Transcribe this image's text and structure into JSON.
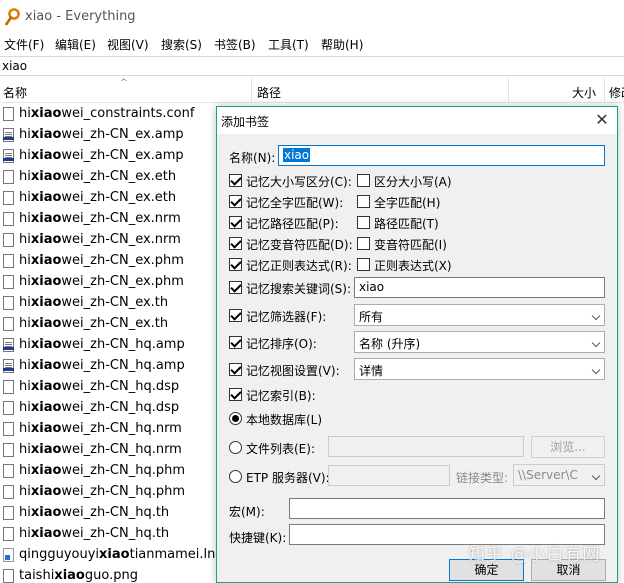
{
  "window": {
    "title": "xiao - Everything",
    "menu": [
      "文件(F)",
      "编辑(E)",
      "视图(V)",
      "搜索(S)",
      "书签(B)",
      "工具(T)",
      "帮助(H)"
    ],
    "search_value": "xiao"
  },
  "columns": {
    "name": "名称",
    "path": "路径",
    "size": "大小",
    "modified": "修改"
  },
  "files": [
    {
      "pre": "hi",
      "hl": "xiao",
      "post": "wei_constraints.conf",
      "icon": "file-icon"
    },
    {
      "pre": "hi",
      "hl": "xiao",
      "post": "wei_zh-CN_ex.amp",
      "icon": "amp-file-icon"
    },
    {
      "pre": "hi",
      "hl": "xiao",
      "post": "wei_zh-CN_ex.amp",
      "icon": "amp-file-icon"
    },
    {
      "pre": "hi",
      "hl": "xiao",
      "post": "wei_zh-CN_ex.eth",
      "icon": "file-icon"
    },
    {
      "pre": "hi",
      "hl": "xiao",
      "post": "wei_zh-CN_ex.eth",
      "icon": "file-icon"
    },
    {
      "pre": "hi",
      "hl": "xiao",
      "post": "wei_zh-CN_ex.nrm",
      "icon": "file-icon"
    },
    {
      "pre": "hi",
      "hl": "xiao",
      "post": "wei_zh-CN_ex.nrm",
      "icon": "file-icon"
    },
    {
      "pre": "hi",
      "hl": "xiao",
      "post": "wei_zh-CN_ex.phm",
      "icon": "file-icon"
    },
    {
      "pre": "hi",
      "hl": "xiao",
      "post": "wei_zh-CN_ex.phm",
      "icon": "file-icon"
    },
    {
      "pre": "hi",
      "hl": "xiao",
      "post": "wei_zh-CN_ex.th",
      "icon": "file-icon"
    },
    {
      "pre": "hi",
      "hl": "xiao",
      "post": "wei_zh-CN_ex.th",
      "icon": "file-icon"
    },
    {
      "pre": "hi",
      "hl": "xiao",
      "post": "wei_zh-CN_hq.amp",
      "icon": "amp-file-icon"
    },
    {
      "pre": "hi",
      "hl": "xiao",
      "post": "wei_zh-CN_hq.amp",
      "icon": "amp-file-icon"
    },
    {
      "pre": "hi",
      "hl": "xiao",
      "post": "wei_zh-CN_hq.dsp",
      "icon": "file-icon"
    },
    {
      "pre": "hi",
      "hl": "xiao",
      "post": "wei_zh-CN_hq.dsp",
      "icon": "file-icon"
    },
    {
      "pre": "hi",
      "hl": "xiao",
      "post": "wei_zh-CN_hq.nrm",
      "icon": "file-icon"
    },
    {
      "pre": "hi",
      "hl": "xiao",
      "post": "wei_zh-CN_hq.nrm",
      "icon": "file-icon"
    },
    {
      "pre": "hi",
      "hl": "xiao",
      "post": "wei_zh-CN_hq.phm",
      "icon": "file-icon"
    },
    {
      "pre": "hi",
      "hl": "xiao",
      "post": "wei_zh-CN_hq.phm",
      "icon": "file-icon"
    },
    {
      "pre": "hi",
      "hl": "xiao",
      "post": "wei_zh-CN_hq.th",
      "icon": "file-icon"
    },
    {
      "pre": "hi",
      "hl": "xiao",
      "post": "wei_zh-CN_hq.th",
      "icon": "file-icon"
    },
    {
      "pre": "qingguyouyi",
      "hl": "xiao",
      "post": "tianmamei.lnk",
      "icon": "shortcut-file-icon"
    },
    {
      "pre": "taishi",
      "hl": "xiao",
      "post": "guo.png",
      "icon": "file-icon"
    }
  ],
  "dialog": {
    "title": "添加书签",
    "name_label": "名称(N):",
    "name_value": "xiao",
    "options": [
      {
        "label": "记忆大小写区分(C):",
        "checked": true,
        "sub_label": "区分大小写(A)",
        "sub_checked": false
      },
      {
        "label": "记忆全字匹配(W):",
        "checked": true,
        "sub_label": "全字匹配(H)",
        "sub_checked": false
      },
      {
        "label": "记忆路径匹配(P):",
        "checked": true,
        "sub_label": "路径匹配(T)",
        "sub_checked": false
      },
      {
        "label": "记忆变音符匹配(D):",
        "checked": true,
        "sub_label": "变音符匹配(I)",
        "sub_checked": false
      },
      {
        "label": "记忆正则表达式(R):",
        "checked": true,
        "sub_label": "正则表达式(X)",
        "sub_checked": false
      }
    ],
    "search_keyword": {
      "label": "记忆搜索关键词(S):",
      "checked": true,
      "value": "xiao"
    },
    "filter": {
      "label": "记忆筛选器(F):",
      "checked": true,
      "value": "所有"
    },
    "sort": {
      "label": "记忆排序(O):",
      "checked": true,
      "value": "名称 (升序)"
    },
    "view": {
      "label": "记忆视图设置(V):",
      "checked": true,
      "value": "详情"
    },
    "index": {
      "label": "记忆索引(B):",
      "checked": true
    },
    "local_db": {
      "label": "本地数据库(L)",
      "selected": true
    },
    "file_list": {
      "label": "文件列表(E):",
      "selected": false,
      "value": "",
      "browse_label": "浏览..."
    },
    "etp": {
      "label": "ETP 服务器(V):",
      "selected": false,
      "value": "",
      "link_type_label": "链接类型:",
      "link_type_value": "\\\\Server\\C"
    },
    "macro": {
      "label": "宏(M):",
      "value": ""
    },
    "hotkey": {
      "label": "快捷键(K):",
      "value": ""
    },
    "ok_label": "确定",
    "cancel_label": "取消"
  },
  "watermark": "知乎 @小白有网",
  "colors": {
    "accent": "#0078d7",
    "dialog_border": "#1ba866",
    "amp_icon": "#1f3b8f",
    "app_icon": "#e07b00"
  }
}
